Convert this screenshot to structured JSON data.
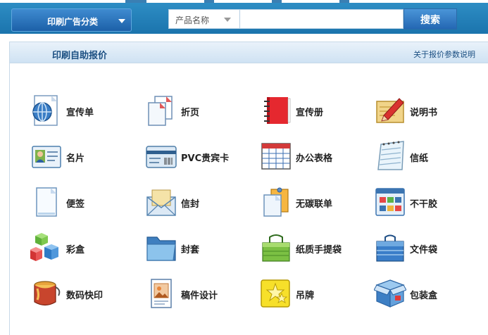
{
  "header": {
    "category_button": "印刷广告分类",
    "search_select": "产品名称",
    "search_placeholder": "",
    "search_button": "搜索"
  },
  "panel": {
    "title": "印刷自助报价",
    "link": "关于报价参数说明"
  },
  "products": [
    {
      "label": "宣传单",
      "icon": "globe-flyer-icon"
    },
    {
      "label": "折页",
      "icon": "folded-pages-icon"
    },
    {
      "label": "宣传册",
      "icon": "red-brochure-icon"
    },
    {
      "label": "说明书",
      "icon": "manual-pencil-icon"
    },
    {
      "label": "名片",
      "icon": "business-card-icon"
    },
    {
      "label": "PVC贵宾卡",
      "icon": "vip-card-icon"
    },
    {
      "label": "办公表格",
      "icon": "office-form-icon"
    },
    {
      "label": "信纸",
      "icon": "notepad-icon"
    },
    {
      "label": "便签",
      "icon": "blank-note-icon"
    },
    {
      "label": "信封",
      "icon": "envelope-icon"
    },
    {
      "label": "无碳联单",
      "icon": "carbonless-form-icon"
    },
    {
      "label": "不干胶",
      "icon": "sticker-sheet-icon"
    },
    {
      "label": "彩盒",
      "icon": "color-boxes-icon"
    },
    {
      "label": "封套",
      "icon": "folder-icon"
    },
    {
      "label": "纸质手提袋",
      "icon": "green-bag-icon"
    },
    {
      "label": "文件袋",
      "icon": "file-bag-icon"
    },
    {
      "label": "数码快印",
      "icon": "paint-bucket-icon"
    },
    {
      "label": "稿件设计",
      "icon": "design-doc-icon"
    },
    {
      "label": "吊牌",
      "icon": "hang-tag-icon"
    },
    {
      "label": "包装盒",
      "icon": "package-box-icon"
    }
  ]
}
